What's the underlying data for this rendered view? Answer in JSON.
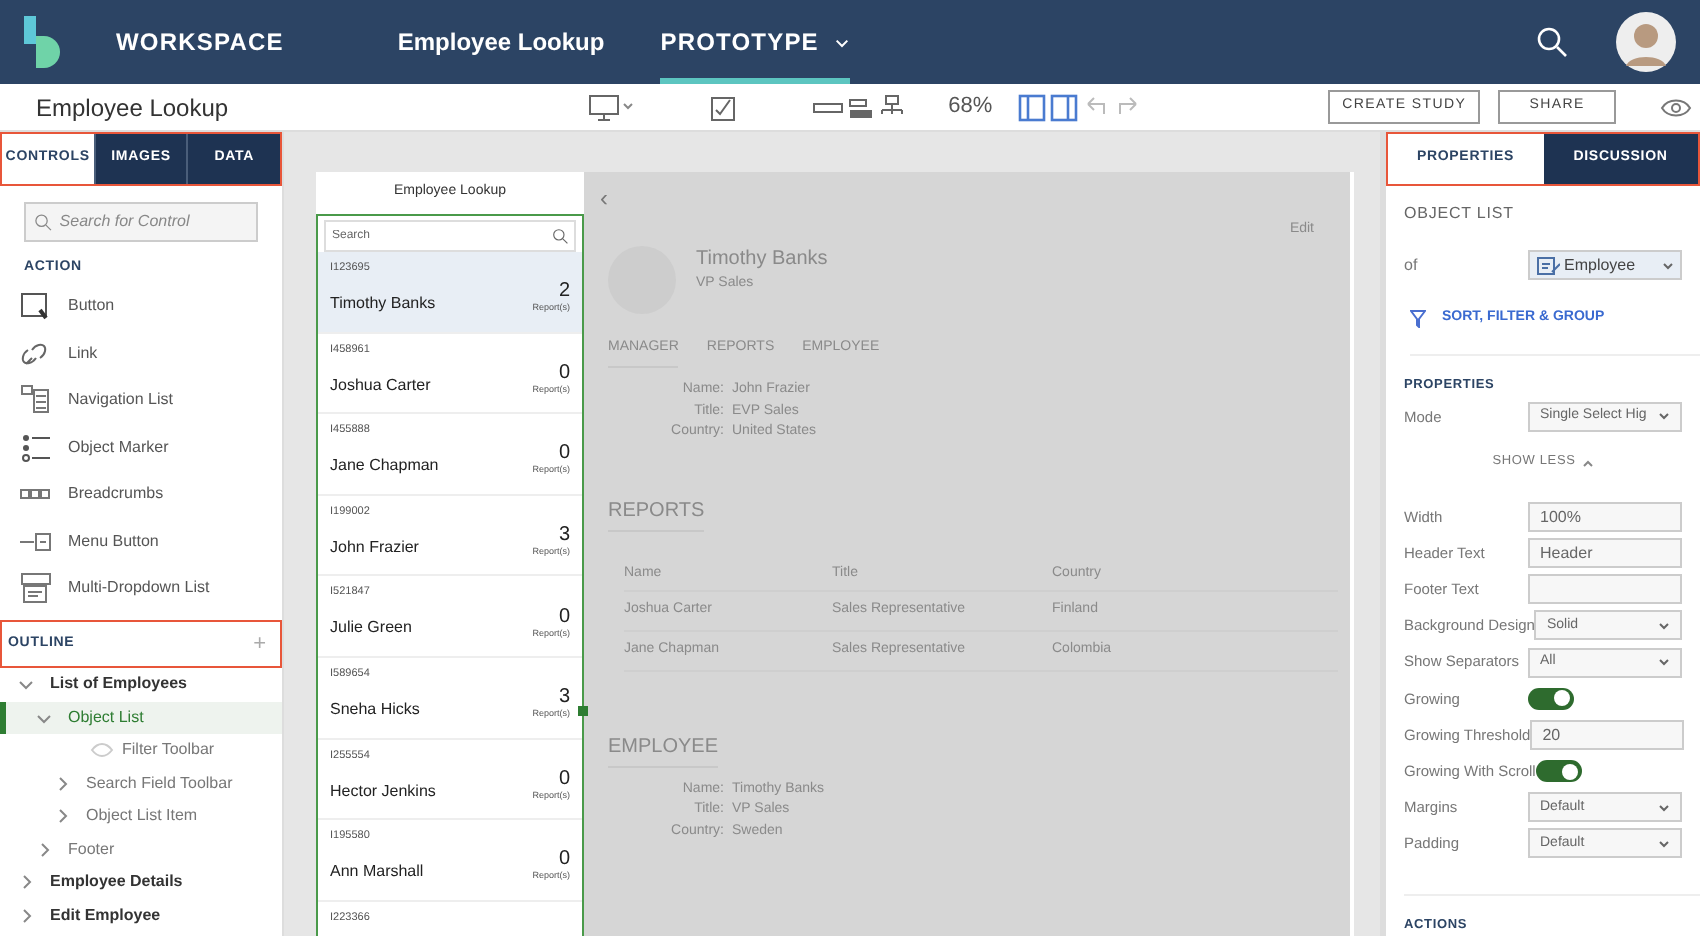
{
  "header": {
    "workspace": "WORKSPACE",
    "project": "Employee Lookup",
    "mode": {
      "label": "PROTOTYPE",
      "selected": true
    }
  },
  "toolbar": {
    "page_title": "Employee Lookup",
    "zoom": "68%",
    "buttons": [
      "CREATE STUDY",
      "SHARE"
    ]
  },
  "left_panel": {
    "tabs": [
      {
        "label": "CONTROLS",
        "selected": true
      },
      {
        "label": "IMAGES",
        "selected": false
      },
      {
        "label": "DATA",
        "selected": false
      }
    ],
    "search": {
      "placeholder": "Search for Control"
    },
    "section": "ACTION",
    "controls": [
      {
        "label": "Button"
      },
      {
        "label": "Link"
      },
      {
        "label": "Navigation List"
      },
      {
        "label": "Object Marker"
      },
      {
        "label": "Breadcrumbs"
      },
      {
        "label": "Menu Button"
      },
      {
        "label": "Multi-Dropdown List"
      }
    ],
    "outline": {
      "title": "OUTLINE",
      "add": "+",
      "tree": [
        {
          "label": "List of Employees",
          "expanded": true,
          "selected": false,
          "bold": true,
          "children": [
            {
              "label": "Object List",
              "expanded": true,
              "selected": true,
              "bold": false,
              "children": [
                {
                  "label": "Filter Toolbar",
                  "hidden": true,
                  "selected": false,
                  "bold": false
                },
                {
                  "label": "Search Field Toolbar",
                  "expanded": false,
                  "selected": false,
                  "bold": false
                },
                {
                  "label": "Object List Item",
                  "expanded": false,
                  "selected": false,
                  "bold": false
                }
              ]
            },
            {
              "label": "Footer",
              "expanded": false,
              "selected": false,
              "bold": false
            }
          ]
        },
        {
          "label": "Employee Details",
          "expanded": false,
          "selected": false,
          "bold": true
        },
        {
          "label": "Edit Employee",
          "expanded": false,
          "selected": false,
          "bold": true
        }
      ]
    }
  },
  "preview": {
    "title": "Employee Lookup",
    "search": {
      "placeholder": "Search"
    },
    "items": [
      {
        "id": "I123695",
        "name": "Timothy Banks",
        "count": "2",
        "count_label": "Report(s)",
        "selected": true
      },
      {
        "id": "I458961",
        "name": "Joshua Carter",
        "count": "0",
        "count_label": "Report(s)",
        "selected": false
      },
      {
        "id": "I455888",
        "name": "Jane Chapman",
        "count": "0",
        "count_label": "Report(s)",
        "selected": false
      },
      {
        "id": "I199002",
        "name": "John Frazier",
        "count": "3",
        "count_label": "Report(s)",
        "selected": false
      },
      {
        "id": "I521847",
        "name": "Julie Green",
        "count": "0",
        "count_label": "Report(s)",
        "selected": false
      },
      {
        "id": "I589654",
        "name": "Sneha Hicks",
        "count": "3",
        "count_label": "Report(s)",
        "selected": false
      },
      {
        "id": "I255554",
        "name": "Hector Jenkins",
        "count": "0",
        "count_label": "Report(s)",
        "selected": false
      },
      {
        "id": "I195580",
        "name": "Ann Marshall",
        "count": "0",
        "count_label": "Report(s)",
        "selected": false
      },
      {
        "id": "I223366",
        "selected": false
      }
    ],
    "details": {
      "back": "‹",
      "edit": "Edit",
      "name": "Timothy Banks",
      "role": "VP Sales",
      "tabs": [
        {
          "label": "MANAGER",
          "selected": true
        },
        {
          "label": "REPORTS",
          "selected": false
        },
        {
          "label": "EMPLOYEE",
          "selected": false
        }
      ],
      "manager": [
        {
          "label": "Name:",
          "value": "John Frazier"
        },
        {
          "label": "Title:",
          "value": "EVP Sales"
        },
        {
          "label": "Country:",
          "value": "United States"
        }
      ],
      "reports_heading": "REPORTS",
      "columns": [
        "Name",
        "Title",
        "Country"
      ],
      "rows": [
        [
          "Joshua Carter",
          "Sales Representative",
          "Finland"
        ],
        [
          "Jane Chapman",
          "Sales Representative",
          "Colombia"
        ]
      ],
      "employee_heading": "EMPLOYEE",
      "employee": [
        {
          "label": "Name:",
          "value": "Timothy Banks"
        },
        {
          "label": "Title:",
          "value": "VP Sales"
        },
        {
          "label": "Country:",
          "value": "Sweden"
        }
      ]
    }
  },
  "right_panel": {
    "tabs": [
      {
        "label": "PROPERTIES",
        "selected": true
      },
      {
        "label": "DISCUSSION",
        "selected": false
      }
    ],
    "title": "OBJECT LIST",
    "of_label": "of",
    "entity": "Employee",
    "sort_link": "SORT, FILTER & GROUP",
    "properties_heading": "PROPERTIES",
    "mode": {
      "label": "Mode",
      "value": "Single Select Hig"
    },
    "show_less": "SHOW LESS",
    "properties": [
      {
        "kind": "input",
        "label": "Width",
        "value": "100%"
      },
      {
        "kind": "input",
        "label": "Header Text",
        "value": "Header"
      },
      {
        "kind": "input",
        "label": "Footer Text"
      },
      {
        "kind": "select",
        "label": "Background Design",
        "value": "Solid"
      },
      {
        "kind": "select",
        "label": "Show Separators",
        "value": "All"
      },
      {
        "kind": "toggle",
        "label": "Growing",
        "on": true
      },
      {
        "kind": "input",
        "label": "Growing Threshold",
        "value": "20"
      },
      {
        "kind": "toggle",
        "label": "Growing With Scroll",
        "on": true
      },
      {
        "kind": "select",
        "label": "Margins",
        "value": "Default"
      },
      {
        "kind": "select",
        "label": "Padding",
        "value": "Default"
      }
    ],
    "actions_heading": "ACTIONS"
  }
}
